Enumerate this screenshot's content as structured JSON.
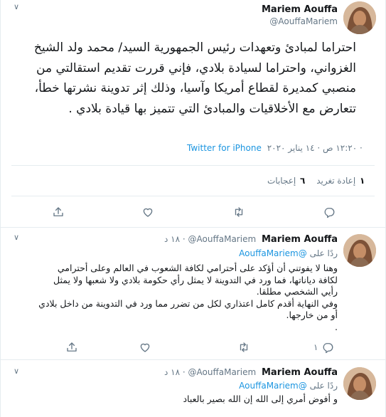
{
  "main_tweet": {
    "display_name": "Mariem Aouffa",
    "handle": "@AouffaMariem",
    "text": "احتراما لمبادئ وتعهدات رئيس الجمهورية السيد/ محمد ولد الشيخ الغزواني، واحتراما لسيادة بلادي، فإني قررت تقديم استقالتي من منصبي كمديرة لقطاع أمريكا وآسيا، وذلك إثر تدوينة نشرتها خطأ، تتعارض مع الأخلاقيات والمبادئ التي تتميز بها قيادة بلادي .",
    "timestamp": "١٢:٢٠ ص · ١٤ يناير ٢٠٢٠ ·",
    "source": "Twitter for iPhone",
    "stats": {
      "retweets_count": "١",
      "retweets_label": "إعادة تغريد",
      "likes_count": "٦",
      "likes_label": "إعجابات"
    },
    "actions": {
      "reply_icon": "reply-icon",
      "retweet_icon": "retweet-icon",
      "like_icon": "heart-icon",
      "share_icon": "share-icon"
    }
  },
  "replies": [
    {
      "display_name": "Mariem Aouffa",
      "handle": "@AouffaMariem",
      "time": "١٨ د",
      "replying_label": "ردًا على",
      "replying_to": "@AouffaMariem",
      "lines": [
        "وهنا لا يفوتني أن أؤكد على أحترامي لكافة الشعوب في العالم وعلى أحترامي",
        "لكافة دياناتها، فما ورد في التدوينة لا يمثل رأي حكومة بلادي ولا شعبها ولا يمثل",
        "رأيي الشخصي مطلقا.",
        "وفي النهاية أقدم كامل اعتذاري لكل من تضرر مما ورد في التدوينة من داخل بلادي",
        "أو من خارجها.",
        "."
      ],
      "reply_count": "١"
    },
    {
      "display_name": "Mariem Aouffa",
      "handle": "@AouffaMariem",
      "time": "١٨ د",
      "replying_label": "ردًا على",
      "replying_to": "@AouffaMariem",
      "lines": [
        "و أفوض أمري إلى الله إن الله بصير بالعباد"
      ]
    }
  ],
  "colors": {
    "link": "#1b95e0",
    "muted": "#657786",
    "border": "#e6ecf0"
  }
}
